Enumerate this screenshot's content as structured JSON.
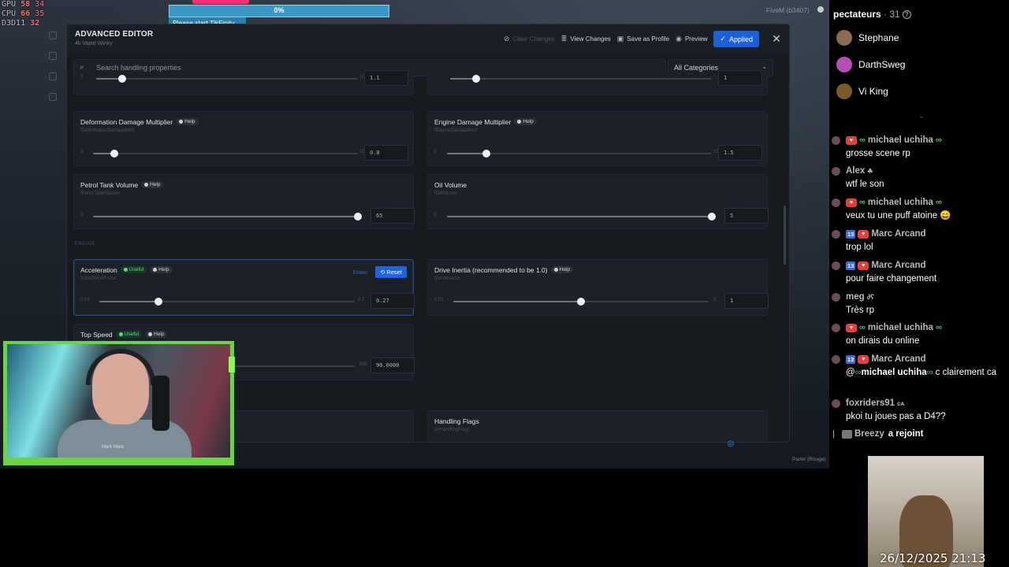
{
  "hud": {
    "gpu_label": "GPU",
    "gpu_val": "58",
    "gpu_temp": "34",
    "cpu_label": "CPU",
    "cpu_val": "66",
    "cpu_temp": "35",
    "fps_label": "D3D11",
    "fps_val": "32"
  },
  "tikfinity": {
    "progress": "0%",
    "progress_fraction": 0.0,
    "message": "Please start TikFinity"
  },
  "game_hud_right": "FiveM (b3407)",
  "editor": {
    "title": "ADVANCED EDITOR",
    "subtitle": "4k Vapid Winky",
    "actions": {
      "clear": "Clear Changes",
      "view": "View Changes",
      "save": "Save as Profile",
      "preview": "Preview",
      "applied": "Applied"
    },
    "search_placeholder": "Search handling properties",
    "category": "All Categories",
    "section_engine": "ENGINE",
    "cards": {
      "top_left": {
        "min": "0",
        "max": "10",
        "value": "1.1",
        "level": 0.1
      },
      "top_right": {
        "value": "1",
        "level": 0.1
      },
      "deformation": {
        "label": "Deformation Damage Multiplier",
        "key": "fDeformationDamageMult",
        "min": "0",
        "max": "10",
        "value": "0.8",
        "level": 0.08
      },
      "engine_damage": {
        "label": "Engine Damage Multiplier",
        "key": "fEngineDamageMult",
        "min": "0",
        "max": "10",
        "value": "1.5",
        "level": 0.15
      },
      "petrol": {
        "label": "Petrol Tank Volume",
        "key": "fPetrolTankVolume",
        "min": "0",
        "value": "65",
        "level": 1.0
      },
      "oil": {
        "label": "Oil Volume",
        "key": "fOilVolume",
        "min": "0",
        "value": "5",
        "level": 1.0
      },
      "acceleration": {
        "label": "Acceleration",
        "key": "fInitialDriveForce",
        "min": "0.01",
        "max": "0.7",
        "value": "0.27",
        "level": 0.23,
        "edited": "Edited",
        "reset": "Reset"
      },
      "drive_inertia": {
        "label": "Drive Inertia (recommended to be 1.0)",
        "key": "fDriveInertia",
        "min": "0.01",
        "max": "2",
        "value": "1",
        "level": 0.5
      },
      "top_speed": {
        "label": "Top Speed",
        "max": "500",
        "value": "90.0000"
      },
      "handling_flags": {
        "label": "Handling Flags",
        "key": "strHandlingFlags"
      }
    },
    "tag_help": "Help",
    "tag_useful": "Useful",
    "bottom_hud": "Parler (Rouge)"
  },
  "webcam_caption": "Mark Mate",
  "chat": {
    "viewers_title": "pectateurs",
    "viewers_count": "· 31",
    "viewers": [
      {
        "name": "Stephane",
        "color": "#8b6b52"
      },
      {
        "name": "DarthSweg",
        "color": "#b24fb2"
      },
      {
        "name": "Vi King",
        "color": "#7a5a2b"
      }
    ],
    "messages": [
      {
        "name": "michael uchiha",
        "text": "grosse scene rp"
      },
      {
        "name": "Alex",
        "text": "wtf le son"
      },
      {
        "name": "michael uchiha",
        "text": "veux tu une puff atoine 😄"
      },
      {
        "name": "Marc Arcand",
        "badge": "13",
        "text": "trop lol"
      },
      {
        "name": "Marc Arcand",
        "badge": "13",
        "text": "pour faire changement"
      },
      {
        "name": "meg",
        "text": "Très rp"
      },
      {
        "name": "michael uchiha",
        "text": "on dirais du online"
      },
      {
        "name": "Marc Arcand",
        "badge": "13",
        "text_prefix": "@",
        "mention": "michael uchiha",
        "text_suffix": " c clairement ca"
      },
      {
        "name": "foxriders91",
        "text": "pkoi tu joues pas a D4??"
      }
    ],
    "join_name": "Breezy",
    "join_text": "a rejoint"
  },
  "timestamp": "26/12/2025 21:13"
}
